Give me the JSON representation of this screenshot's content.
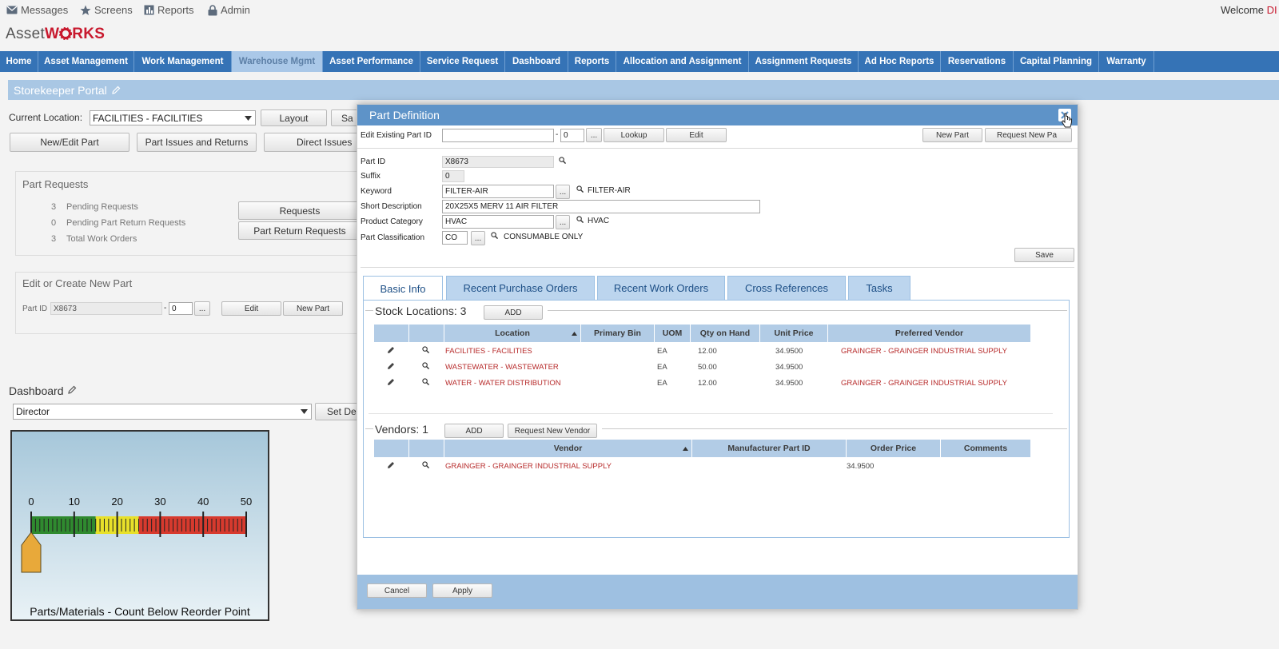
{
  "topbar": {
    "links": [
      {
        "label": "Messages",
        "icon": "envelope-icon"
      },
      {
        "label": "Screens",
        "icon": "star-icon"
      },
      {
        "label": "Reports",
        "icon": "chart-icon"
      },
      {
        "label": "Admin",
        "icon": "lock-icon"
      }
    ],
    "welcome": "Welcome",
    "welcome_user": "DI"
  },
  "logo": {
    "part1": "Asset",
    "part2": "W",
    "part3": "RKS"
  },
  "nav": [
    "Home",
    "Asset Management",
    "Work Management",
    "Warehouse Mgmt",
    "Asset Performance",
    "Service Request",
    "Dashboard",
    "Reports",
    "Allocation and Assignment",
    "Assignment Requests",
    "Ad Hoc Reports",
    "Reservations",
    "Capital Planning",
    "Warranty"
  ],
  "portal": {
    "title": "Storekeeper Portal"
  },
  "location": {
    "label": "Current Location:",
    "value": "FACILITIES - FACILITIES",
    "layout_btn": "Layout",
    "save_btn": "Sa"
  },
  "portal_buttons": {
    "new_edit": "New/Edit Part",
    "issues_returns": "Part Issues and Returns",
    "direct_issues": "Direct Issues"
  },
  "part_requests": {
    "title": "Part Requests",
    "rows": [
      {
        "count": "3",
        "label": "Pending Requests"
      },
      {
        "count": "0",
        "label": "Pending Part Return Requests"
      },
      {
        "count": "3",
        "label": "Total Work Orders"
      }
    ],
    "requests_btn": "Requests",
    "return_btn": "Part Return Requests"
  },
  "edit_create": {
    "title": "Edit or Create New Part",
    "part_id_label": "Part ID",
    "part_id": "X8673",
    "suffix": "0",
    "dots": "...",
    "edit_btn": "Edit",
    "new_btn": "New Part"
  },
  "dashboard": {
    "title": "Dashboard",
    "select_value": "Director",
    "set_btn": "Set De"
  },
  "gauge": {
    "ticks": [
      "0",
      "10",
      "20",
      "30",
      "40",
      "50"
    ],
    "value": 0,
    "max": 50,
    "caption": "Parts/Materials - Count Below Reorder Point"
  },
  "modal": {
    "title": "Part Definition",
    "edit_existing_label": "Edit Existing Part ID",
    "edit_existing_value": "",
    "edit_existing_suffix": "0",
    "dots": "...",
    "lookup_btn": "Lookup",
    "edit_btn": "Edit",
    "new_part_btn": "New Part",
    "request_new_btn": "Request New Pa",
    "fields": {
      "part_id": {
        "label": "Part ID",
        "value": "X8673"
      },
      "suffix": {
        "label": "Suffix",
        "value": "0"
      },
      "keyword": {
        "label": "Keyword",
        "value": "FILTER-AIR",
        "desc": "FILTER-AIR"
      },
      "short_desc": {
        "label": "Short Description",
        "value": "20X25X5 MERV 11 AIR FILTER"
      },
      "product_category": {
        "label": "Product Category",
        "value": "HVAC",
        "desc": "HVAC"
      },
      "part_class": {
        "label": "Part Classification",
        "value": "CO",
        "desc": "CONSUMABLE ONLY"
      }
    },
    "save_btn": "Save",
    "tabs": [
      "Basic Info",
      "Recent Purchase Orders",
      "Recent Work Orders",
      "Cross References",
      "Tasks"
    ],
    "stock": {
      "title": "Stock Locations: 3",
      "add_btn": "ADD",
      "headers": [
        "Location",
        "Primary Bin",
        "UOM",
        "Qty on Hand",
        "Unit Price",
        "Preferred Vendor"
      ],
      "rows": [
        {
          "location": "FACILITIES - FACILITIES",
          "bin": "",
          "uom": "EA",
          "qty": "12.00",
          "price": "34.9500",
          "vendor": "GRAINGER - GRAINGER INDUSTRIAL SUPPLY"
        },
        {
          "location": "WASTEWATER - WASTEWATER",
          "bin": "",
          "uom": "EA",
          "qty": "50.00",
          "price": "34.9500",
          "vendor": ""
        },
        {
          "location": "WATER - WATER DISTRIBUTION",
          "bin": "",
          "uom": "EA",
          "qty": "12.00",
          "price": "34.9500",
          "vendor": "GRAINGER - GRAINGER INDUSTRIAL SUPPLY"
        }
      ]
    },
    "vendors": {
      "title": "Vendors: 1",
      "add_btn": "ADD",
      "request_btn": "Request New Vendor",
      "headers": [
        "Vendor",
        "Manufacturer Part ID",
        "Order Price",
        "Comments"
      ],
      "rows": [
        {
          "vendor": "GRAINGER - GRAINGER INDUSTRIAL SUPPLY",
          "mfr_id": "",
          "price": "34.9500",
          "comments": ""
        }
      ]
    },
    "cancel_btn": "Cancel",
    "apply_btn": "Apply"
  },
  "colors": {
    "nav": "#3573b6",
    "modal_head": "#5e93c8",
    "link_red": "#b72b2b"
  }
}
